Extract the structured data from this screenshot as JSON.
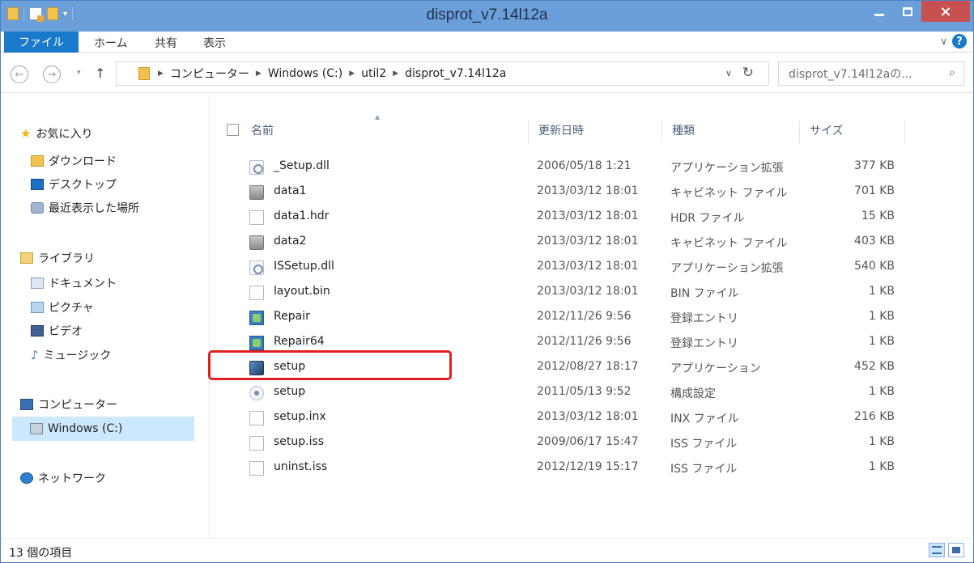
{
  "window": {
    "title": "disprot_v7.14l12a",
    "minimize": "",
    "maximize": "",
    "close": "×"
  },
  "ribbon": {
    "file_tab": "ファイル",
    "tabs": [
      "ホーム",
      "共有",
      "表示"
    ],
    "help": "?"
  },
  "address": {
    "crumbs": [
      "コンピューター",
      "Windows (C:)",
      "util2",
      "disprot_v7.14l12a"
    ],
    "search_placeholder": "disprot_v7.14l12aの..."
  },
  "nav": {
    "favorites": "お気に入り",
    "downloads": "ダウンロード",
    "desktop": "デスクトップ",
    "recent": "最近表示した場所",
    "libraries": "ライブラリ",
    "documents": "ドキュメント",
    "pictures": "ピクチャ",
    "videos": "ビデオ",
    "music": "ミュージック",
    "computer": "コンピューター",
    "drive_c": "Windows (C:)",
    "network": "ネットワーク"
  },
  "columns": {
    "name": "名前",
    "date": "更新日時",
    "type": "種類",
    "size": "サイズ"
  },
  "files": [
    {
      "name": "_Setup.dll",
      "date": "2006/05/18 1:21",
      "type": "アプリケーション拡張",
      "size": "377 KB",
      "icon": "dll-icon"
    },
    {
      "name": "data1",
      "date": "2013/03/12 18:01",
      "type": "キャビネット ファイル",
      "size": "701 KB",
      "icon": "cabinet-icon"
    },
    {
      "name": "data1.hdr",
      "date": "2013/03/12 18:01",
      "type": "HDR ファイル",
      "size": "15 KB",
      "icon": "file-icon"
    },
    {
      "name": "data2",
      "date": "2013/03/12 18:01",
      "type": "キャビネット ファイル",
      "size": "403 KB",
      "icon": "cabinet-icon"
    },
    {
      "name": "ISSetup.dll",
      "date": "2013/03/12 18:01",
      "type": "アプリケーション拡張",
      "size": "540 KB",
      "icon": "dll-icon"
    },
    {
      "name": "layout.bin",
      "date": "2013/03/12 18:01",
      "type": "BIN ファイル",
      "size": "1 KB",
      "icon": "file-icon"
    },
    {
      "name": "Repair",
      "date": "2012/11/26 9:56",
      "type": "登録エントリ",
      "size": "1 KB",
      "icon": "registry-icon"
    },
    {
      "name": "Repair64",
      "date": "2012/11/26 9:56",
      "type": "登録エントリ",
      "size": "1 KB",
      "icon": "registry-icon"
    },
    {
      "name": "setup",
      "date": "2012/08/27 18:17",
      "type": "アプリケーション",
      "size": "452 KB",
      "icon": "setup-exe-icon"
    },
    {
      "name": "setup",
      "date": "2011/05/13 9:52",
      "type": "構成設定",
      "size": "1 KB",
      "icon": "config-icon"
    },
    {
      "name": "setup.inx",
      "date": "2013/03/12 18:01",
      "type": "INX ファイル",
      "size": "216 KB",
      "icon": "file-icon"
    },
    {
      "name": "setup.iss",
      "date": "2009/06/17 15:47",
      "type": "ISS ファイル",
      "size": "1 KB",
      "icon": "file-icon"
    },
    {
      "name": "uninst.iss",
      "date": "2012/12/19 15:17",
      "type": "ISS ファイル",
      "size": "1 KB",
      "icon": "file-icon"
    }
  ],
  "status": {
    "item_count": "13 個の項目"
  },
  "colors": {
    "titlebar": "#6b9fd9",
    "file_tab": "#1979ca",
    "close_button": "#c75050",
    "highlight_box": "#e0201f",
    "selected_nav": "#cce8ff"
  }
}
